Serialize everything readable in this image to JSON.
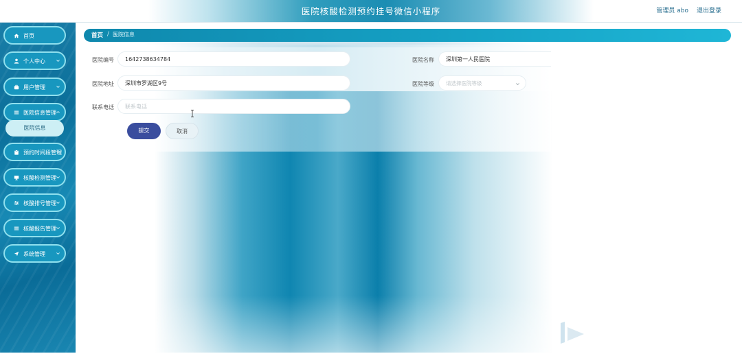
{
  "header": {
    "title": "医院核酸检测预约挂号微信小程序",
    "user_label": "管理员 abo",
    "logout_label": "退出登录"
  },
  "sidebar": {
    "items": [
      {
        "label": "首页",
        "icon": "home-icon",
        "has_chevron": false
      },
      {
        "label": "个人中心",
        "icon": "user-icon",
        "has_chevron": true
      },
      {
        "label": "用户管理",
        "icon": "briefcase-icon",
        "has_chevron": true
      },
      {
        "label": "医院信息管理",
        "icon": "list-icon",
        "has_chevron": true,
        "expanded": true
      },
      {
        "label": "预约时间段管理",
        "icon": "clipboard-icon",
        "has_chevron": true
      },
      {
        "label": "核酸检测管理",
        "icon": "monitor-icon",
        "has_chevron": true
      },
      {
        "label": "核酸排号管理",
        "icon": "sliders-icon",
        "has_chevron": true
      },
      {
        "label": "核酸报告管理",
        "icon": "list-icon",
        "has_chevron": true
      },
      {
        "label": "系统管理",
        "icon": "send-icon",
        "has_chevron": true
      }
    ],
    "submenu": {
      "label": "医院信息"
    }
  },
  "breadcrumb": {
    "home": "首页",
    "separator": "/",
    "current": "医院信息"
  },
  "form": {
    "hospital_no": {
      "label": "医院编号",
      "value": "1642738634784"
    },
    "hospital_name": {
      "label": "医院名称",
      "value": "深圳第一人民医院"
    },
    "hospital_address": {
      "label": "医院地址",
      "value": "深圳市罗湖区9号"
    },
    "hospital_level": {
      "label": "医院等级",
      "placeholder": "请选择医院等级"
    },
    "phone": {
      "label": "联系电话",
      "placeholder": "联系电话"
    },
    "submit_label": "提交",
    "cancel_label": "取消"
  },
  "colors": {
    "accent": "#1897bf",
    "menu_border": "#8fe0ee",
    "submit": "#3a4d9e",
    "breadcrumb": "#16a3c6"
  }
}
